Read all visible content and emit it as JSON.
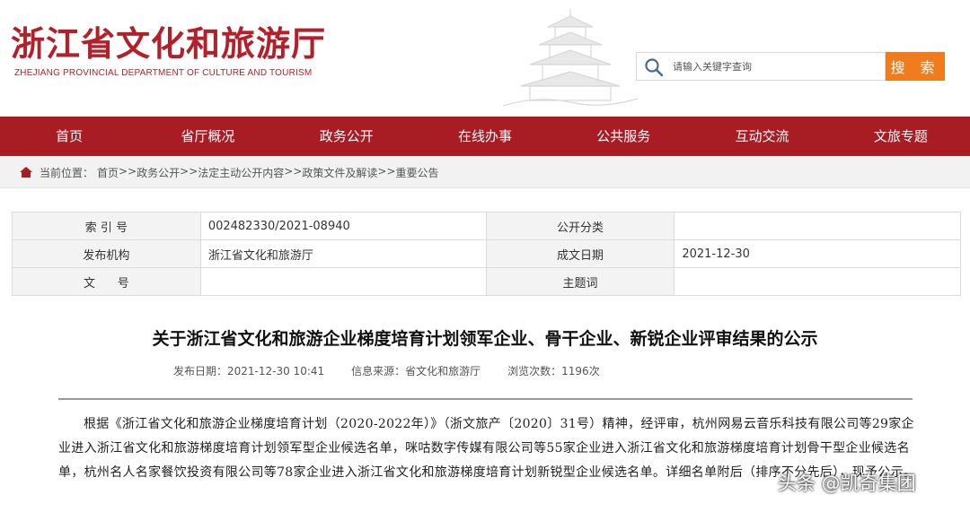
{
  "header": {
    "title": "浙江省文化和旅游厅",
    "subtitle": "ZHEJIANG PROVINCIAL DEPARTMENT OF CULTURE AND TOURISM",
    "search": {
      "placeholder": "请输入关键字查询",
      "button_label": "搜 索"
    }
  },
  "nav": {
    "items": [
      "首页",
      "省厅概况",
      "政务公开",
      "在线办事",
      "公共服务",
      "互动交流",
      "文旅专题"
    ]
  },
  "breadcrumb": {
    "label": "当前位置：",
    "items": [
      "首页",
      "政务公开",
      "法定主动公开内容",
      "政策文件及解读",
      "重要公告"
    ],
    "separator": ">>"
  },
  "info": {
    "index_label": "索 引 号",
    "index_value": "002482330/2021-08940",
    "category_label": "公开分类",
    "category_value": "",
    "publisher_label": "发布机构",
    "publisher_value": "浙江省文化和旅游厅",
    "date_label": "成文日期",
    "date_value": "2021-12-30",
    "doc_label": "文      号",
    "doc_value": "",
    "subject_label": "主题词",
    "subject_value": ""
  },
  "article": {
    "title": "关于浙江省文化和旅游企业梯度培育计划领军企业、骨干企业、新锐企业评审结果的公示",
    "publish_date": "发布日期：2021-12-30 10:41",
    "source": "信息来源：省文化和旅游厅",
    "views": "浏览次数：1196次",
    "body": "根据《浙江省文化和旅游企业梯度培育计划（2020-2022年）》（浙文旅产〔2020〕31号）精神，经评审，杭州网易云音乐科技有限公司等29家企业进入浙江省文化和旅游梯度培育计划领军型企业候选名单，咪咕数字传媒有限公司等55家企业进入浙江省文化和旅游梯度培育计划骨干型企业候选名单，杭州名人名家餐饮投资有限公司等78家企业进入浙江省文化和旅游梯度培育计划新锐型企业候选名单。详细名单附后（排序不分先后），现予公示。"
  },
  "watermark": "头条 @凯奇集团",
  "colors": {
    "brand_red": "#a81c24",
    "search_orange": "#f07c1e"
  }
}
